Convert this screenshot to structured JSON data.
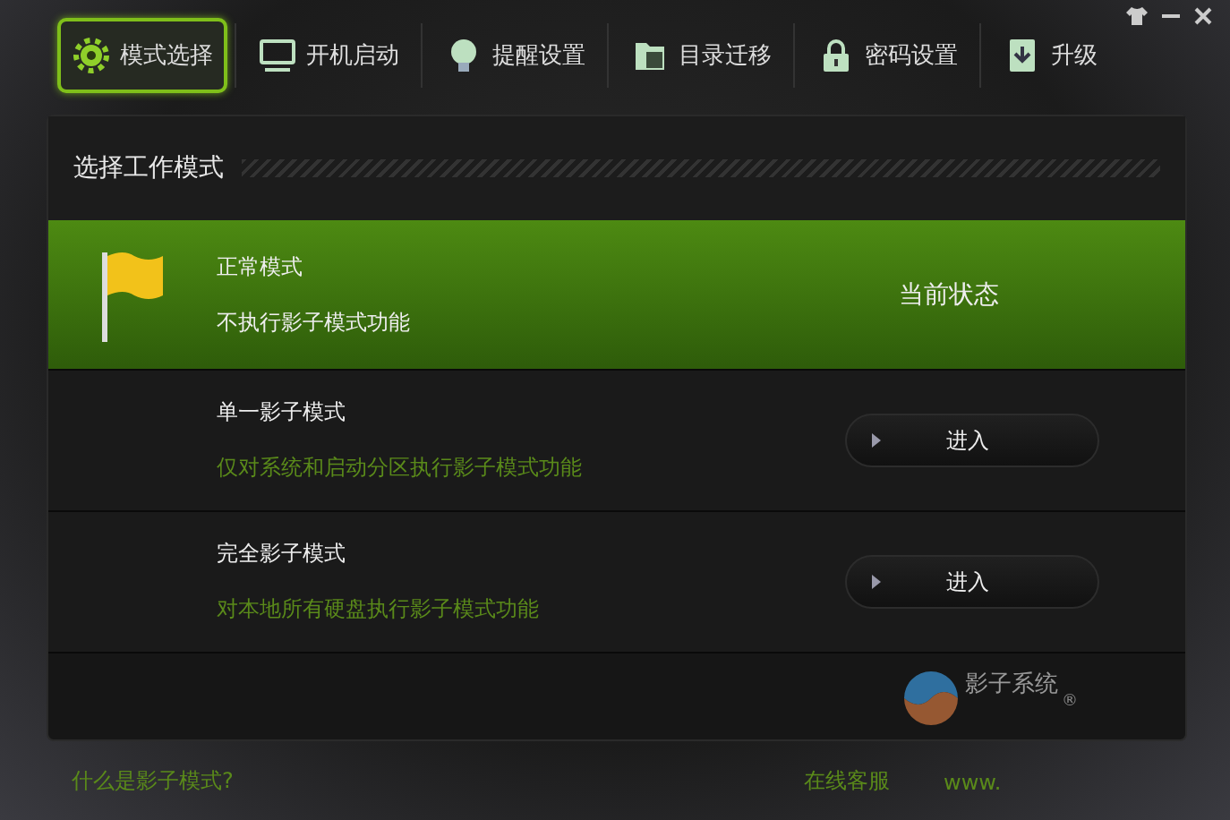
{
  "tabs": [
    {
      "label": "模式选择",
      "kind": "gear",
      "selected": true
    },
    {
      "label": "开机启动",
      "kind": "monitor",
      "selected": false
    },
    {
      "label": "提醒设置",
      "kind": "bulb",
      "selected": false
    },
    {
      "label": "目录迁移",
      "kind": "folder",
      "selected": false
    },
    {
      "label": "密码设置",
      "kind": "lock",
      "selected": false
    },
    {
      "label": "升级",
      "kind": "download",
      "selected": false
    }
  ],
  "panel": {
    "title": "选择工作模式",
    "modes": [
      {
        "title": "正常模式",
        "description": "不执行影子模式功能",
        "selected": true,
        "action": "当前状态"
      },
      {
        "title": "单一影子模式",
        "description": "仅对系统和启动分区执行影子模式功能",
        "selected": false,
        "action": "进入"
      },
      {
        "title": "完全影子模式",
        "description": "对本地所有硬盘执行影子模式功能",
        "selected": false,
        "action": "进入"
      }
    ],
    "logo": {
      "name": "影子系统",
      "mark": "®"
    }
  },
  "footer": {
    "help_link": "什么是影子模式?",
    "service_link": "在线客服",
    "site_link": "www."
  }
}
